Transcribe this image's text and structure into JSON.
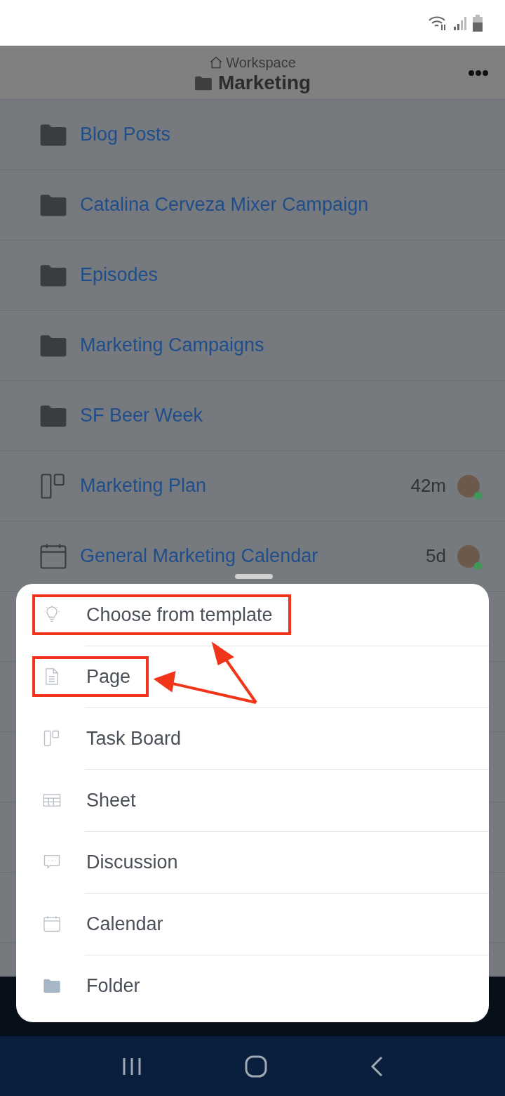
{
  "header": {
    "breadcrumb": "Workspace",
    "title": "Marketing"
  },
  "items": [
    {
      "kind": "folder",
      "name": "Blog Posts"
    },
    {
      "kind": "folder",
      "name": "Catalina Cerveza Mixer Campaign"
    },
    {
      "kind": "folder",
      "name": "Episodes"
    },
    {
      "kind": "folder",
      "name": "Marketing Campaigns"
    },
    {
      "kind": "folder",
      "name": "SF Beer Week"
    },
    {
      "kind": "board",
      "name": "Marketing Plan",
      "time": "42m",
      "online": true
    },
    {
      "kind": "calendar",
      "name": "General Marketing Calendar",
      "time": "5d",
      "online": true
    }
  ],
  "menu": [
    {
      "kind": "template",
      "label": "Choose from template",
      "highlighted": true
    },
    {
      "kind": "page",
      "label": "Page",
      "highlighted": true
    },
    {
      "kind": "board",
      "label": "Task Board",
      "highlighted": false
    },
    {
      "kind": "sheet",
      "label": "Sheet",
      "highlighted": false
    },
    {
      "kind": "discussion",
      "label": "Discussion",
      "highlighted": false
    },
    {
      "kind": "calendar",
      "label": "Calendar",
      "highlighted": false
    },
    {
      "kind": "folder",
      "label": "Folder",
      "highlighted": false
    }
  ]
}
